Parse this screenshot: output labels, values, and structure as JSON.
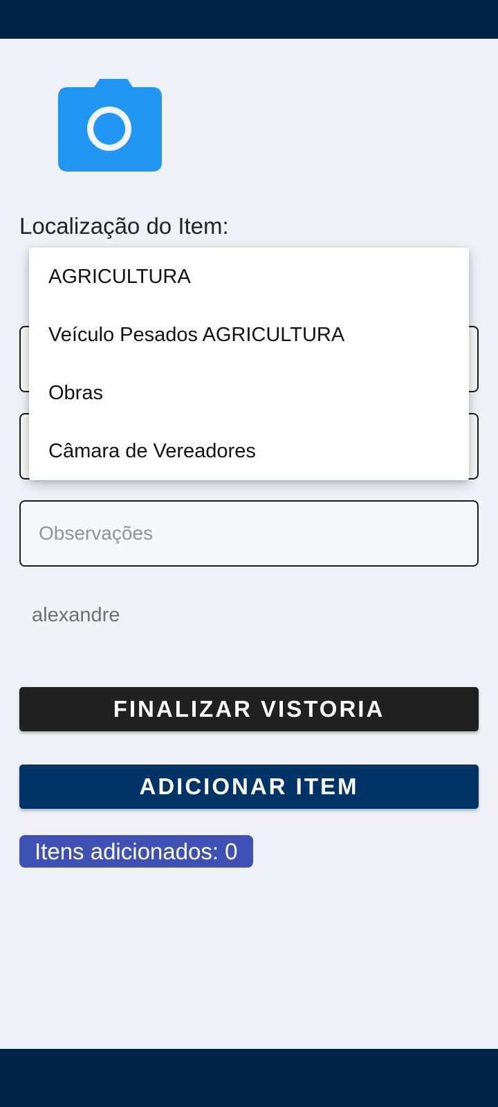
{
  "form": {
    "location_label": "Localização do Item:",
    "observations_placeholder": "Observações",
    "user_name": "alexandre"
  },
  "location_dropdown": {
    "options": [
      {
        "label": "AGRICULTURA"
      },
      {
        "label": "Veículo Pesados AGRICULTURA"
      },
      {
        "label": "Obras"
      },
      {
        "label": "Câmara de Vereadores"
      }
    ]
  },
  "actions": {
    "finalize_label": "FINALIZAR VISTORIA",
    "add_item_label": "ADICIONAR ITEM"
  },
  "status": {
    "items_added_label": "Itens adicionados: 0"
  },
  "icons": {
    "camera": "camera-icon"
  },
  "colors": {
    "status_bar": "#002244",
    "camera_icon": "#2196f3",
    "finalize_button": "#212121",
    "add_item_button": "#003366",
    "items_badge": "#3f51b5"
  }
}
